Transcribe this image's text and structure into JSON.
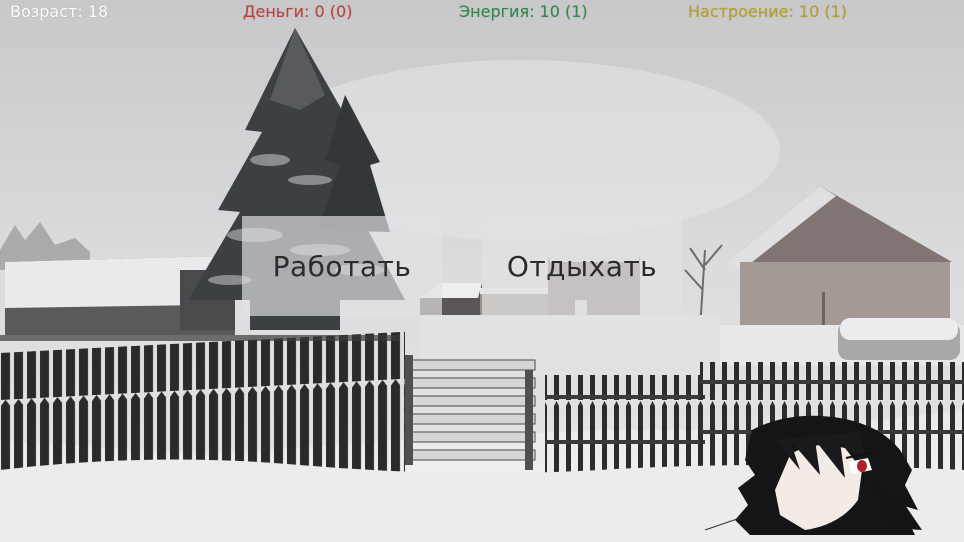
{
  "hud": {
    "age": "Возраст: 18",
    "money": "Деньги: 0 (0)",
    "energy": "Энергия: 10 (1)",
    "mood": "Настроение: 10 (1)"
  },
  "colors": {
    "age": "#ffffff",
    "money": "#c0403c",
    "energy": "#2e8c4a",
    "mood": "#b8a224"
  },
  "actions": {
    "work_label": "Работать",
    "rest_label": "Отдыхать"
  }
}
